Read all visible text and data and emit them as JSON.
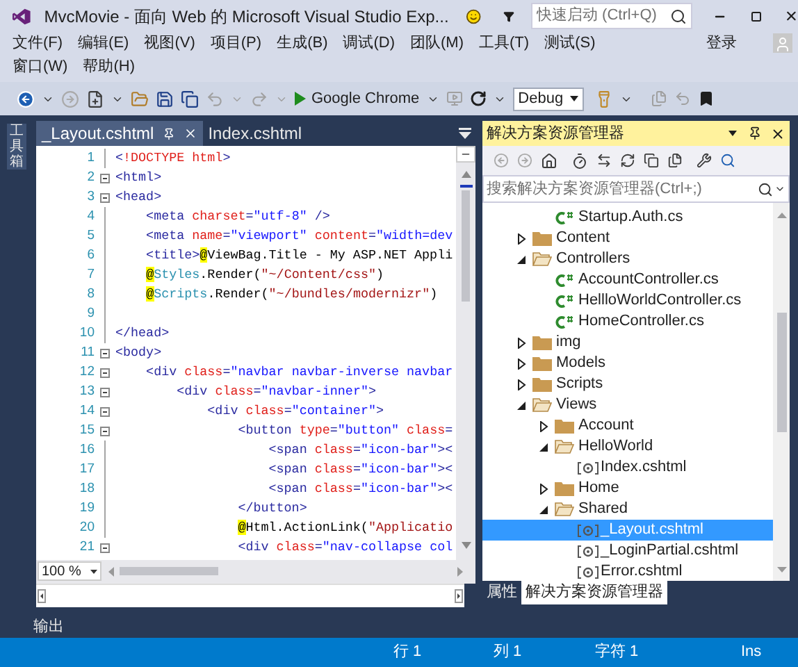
{
  "window": {
    "title": "MvcMovie - 面向 Web 的 Microsoft Visual Studio Exp...",
    "quick_launch": {
      "placeholder": "快速启动 (Ctrl+Q)"
    }
  },
  "menu": [
    "文件(F)",
    "编辑(E)",
    "视图(V)",
    "项目(P)",
    "生成(B)",
    "调试(D)",
    "团队(M)",
    "工具(T)",
    "测试(S)",
    "窗口(W)",
    "帮助(H)"
  ],
  "sign_in": "登录",
  "toolbar": {
    "run_target": "Google Chrome",
    "configuration": "Debug"
  },
  "toolbox": "工具箱",
  "editor": {
    "tabs": [
      {
        "label": "_Layout.cshtml",
        "selected": true
      },
      {
        "label": "Index.cshtml",
        "selected": false
      }
    ],
    "zoom": "100 %",
    "lines": [
      {
        "n": "1",
        "fold": false,
        "tokens": [
          {
            "kind": "tag",
            "text": "<"
          },
          {
            "kind": "attr",
            "text": "!DOCTYPE html"
          },
          {
            "kind": "tag",
            "text": ">"
          }
        ]
      },
      {
        "n": "2",
        "fold": true,
        "tokens": [
          {
            "kind": "tag",
            "text": "<html>"
          }
        ]
      },
      {
        "n": "3",
        "fold": true,
        "tokens": [
          {
            "kind": "tag",
            "text": "<head>"
          }
        ]
      },
      {
        "n": "4",
        "fold": false,
        "tokens": [
          {
            "kind": "tag",
            "text": "    <meta "
          },
          {
            "kind": "attr",
            "text": "charset"
          },
          {
            "kind": "tag",
            "text": "="
          },
          {
            "kind": "value",
            "text": "\"utf-8\""
          },
          {
            "kind": "tag",
            "text": " />"
          }
        ]
      },
      {
        "n": "5",
        "fold": false,
        "tokens": [
          {
            "kind": "tag",
            "text": "    <meta "
          },
          {
            "kind": "attr",
            "text": "name"
          },
          {
            "kind": "tag",
            "text": "="
          },
          {
            "kind": "value",
            "text": "\"viewport\" "
          },
          {
            "kind": "attr",
            "text": "content"
          },
          {
            "kind": "tag",
            "text": "="
          },
          {
            "kind": "value",
            "text": "\"width=dev"
          }
        ]
      },
      {
        "n": "6",
        "fold": false,
        "tokens": [
          {
            "kind": "tag",
            "text": "    <title>"
          },
          {
            "kind": "razor",
            "text": "@"
          },
          {
            "kind": "text",
            "text": "ViewBag.Title - My ASP.NET Appli"
          }
        ]
      },
      {
        "n": "7",
        "fold": false,
        "tokens": [
          {
            "kind": "razor",
            "text": "    @"
          },
          {
            "kind": "type",
            "text": "Styles"
          },
          {
            "kind": "text",
            "text": ".Render("
          },
          {
            "kind": "string",
            "text": "\"~/Content/css\""
          },
          {
            "kind": "text",
            "text": ")"
          }
        ]
      },
      {
        "n": "8",
        "fold": false,
        "tokens": [
          {
            "kind": "razor",
            "text": "    @"
          },
          {
            "kind": "type",
            "text": "Scripts"
          },
          {
            "kind": "text",
            "text": ".Render("
          },
          {
            "kind": "string",
            "text": "\"~/bundles/modernizr\""
          },
          {
            "kind": "text",
            "text": ")"
          }
        ]
      },
      {
        "n": "9",
        "fold": false
      },
      {
        "n": "10",
        "fold": false,
        "tokens": [
          {
            "kind": "tag",
            "text": "</head>"
          }
        ]
      },
      {
        "n": "11",
        "fold": true,
        "tokens": [
          {
            "kind": "tag",
            "text": "<body>"
          }
        ]
      },
      {
        "n": "12",
        "fold": true,
        "tokens": [
          {
            "kind": "tag",
            "text": "    <div "
          },
          {
            "kind": "attr",
            "text": "class"
          },
          {
            "kind": "tag",
            "text": "="
          },
          {
            "kind": "value",
            "text": "\"navbar navbar-inverse navbar"
          }
        ]
      },
      {
        "n": "13",
        "fold": true,
        "tokens": [
          {
            "kind": "tag",
            "text": "        <div "
          },
          {
            "kind": "attr",
            "text": "class"
          },
          {
            "kind": "tag",
            "text": "="
          },
          {
            "kind": "value",
            "text": "\"navbar-inner\""
          },
          {
            "kind": "tag",
            "text": ">"
          }
        ]
      },
      {
        "n": "14",
        "fold": true,
        "tokens": [
          {
            "kind": "tag",
            "text": "            <div "
          },
          {
            "kind": "attr",
            "text": "class"
          },
          {
            "kind": "tag",
            "text": "="
          },
          {
            "kind": "value",
            "text": "\"container\""
          },
          {
            "kind": "tag",
            "text": ">"
          }
        ]
      },
      {
        "n": "15",
        "fold": true,
        "tokens": [
          {
            "kind": "tag",
            "text": "                <button "
          },
          {
            "kind": "attr",
            "text": "type"
          },
          {
            "kind": "tag",
            "text": "="
          },
          {
            "kind": "value",
            "text": "\"button\" "
          },
          {
            "kind": "attr",
            "text": "class"
          },
          {
            "kind": "tag",
            "text": "="
          }
        ]
      },
      {
        "n": "16",
        "fold": false,
        "tokens": [
          {
            "kind": "tag",
            "text": "                    <span "
          },
          {
            "kind": "attr",
            "text": "class"
          },
          {
            "kind": "tag",
            "text": "="
          },
          {
            "kind": "value",
            "text": "\"icon-bar\""
          },
          {
            "kind": "tag",
            "text": "><"
          }
        ]
      },
      {
        "n": "17",
        "fold": false,
        "tokens": [
          {
            "kind": "tag",
            "text": "                    <span "
          },
          {
            "kind": "attr",
            "text": "class"
          },
          {
            "kind": "tag",
            "text": "="
          },
          {
            "kind": "value",
            "text": "\"icon-bar\""
          },
          {
            "kind": "tag",
            "text": "><"
          }
        ]
      },
      {
        "n": "18",
        "fold": false,
        "tokens": [
          {
            "kind": "tag",
            "text": "                    <span "
          },
          {
            "kind": "attr",
            "text": "class"
          },
          {
            "kind": "tag",
            "text": "="
          },
          {
            "kind": "value",
            "text": "\"icon-bar\""
          },
          {
            "kind": "tag",
            "text": "><"
          }
        ]
      },
      {
        "n": "19",
        "fold": false,
        "tokens": [
          {
            "kind": "tag",
            "text": "                </button>"
          }
        ]
      },
      {
        "n": "20",
        "fold": false,
        "tokens": [
          {
            "kind": "razor",
            "text": "                @"
          },
          {
            "kind": "text",
            "text": "Html.ActionLink("
          },
          {
            "kind": "string",
            "text": "\"Applicatio"
          }
        ]
      },
      {
        "n": "21",
        "fold": true,
        "tokens": [
          {
            "kind": "tag",
            "text": "                <div "
          },
          {
            "kind": "attr",
            "text": "class"
          },
          {
            "kind": "tag",
            "text": "="
          },
          {
            "kind": "value",
            "text": "\"nav-collapse col"
          }
        ]
      }
    ]
  },
  "output_tab": "输出",
  "solution_explorer": {
    "title": "解决方案资源管理器",
    "search": {
      "placeholder": "搜索解决方案资源管理器(Ctrl+;)"
    },
    "tree": [
      {
        "children": [
          {
            "kind": "cs",
            "name": "Startup.Auth.cs",
            "selected": false
          }
        ]
      },
      {
        "kind": "folder",
        "name": "Content",
        "expanded": false,
        "selected": false
      },
      {
        "kind": "folder",
        "name": "Controllers",
        "expanded": true,
        "selected": false,
        "children": [
          {
            "kind": "cs",
            "name": "AccountController.cs",
            "selected": false
          },
          {
            "kind": "cs",
            "name": "HellloWorldController.cs",
            "selected": false
          },
          {
            "kind": "cs",
            "name": "HomeController.cs",
            "selected": false
          }
        ]
      },
      {
        "kind": "folder",
        "name": "img",
        "expanded": false,
        "selected": false
      },
      {
        "kind": "folder",
        "name": "Models",
        "expanded": false,
        "selected": false
      },
      {
        "kind": "folder",
        "name": "Scripts",
        "expanded": false,
        "selected": false
      },
      {
        "kind": "folder",
        "name": "Views",
        "expanded": true,
        "selected": false,
        "children": [
          {
            "kind": "folder",
            "name": "Account",
            "expanded": false,
            "selected": false
          },
          {
            "kind": "folder",
            "name": "HelloWorld",
            "expanded": true,
            "selected": false,
            "children": [
              {
                "kind": "cshtml",
                "name": "Index.cshtml",
                "selected": false
              }
            ]
          },
          {
            "kind": "folder",
            "name": "Home",
            "expanded": false,
            "selected": false
          },
          {
            "kind": "folder",
            "name": "Shared",
            "expanded": true,
            "selected": false,
            "children": [
              {
                "kind": "cshtml",
                "name": "_Layout.cshtml",
                "selected": true
              },
              {
                "kind": "cshtml",
                "name": "_LoginPartial.cshtml",
                "selected": false
              },
              {
                "kind": "cshtml",
                "name": "Error.cshtml",
                "selected": false
              }
            ]
          }
        ]
      }
    ],
    "bottom_tabs": [
      {
        "label": "属性",
        "selected": false
      },
      {
        "label": "解决方案资源管理器",
        "selected": true
      }
    ]
  },
  "status_bar": {
    "line": "行 1",
    "column": "列 1",
    "char": "字符 1",
    "mode": "Ins"
  }
}
